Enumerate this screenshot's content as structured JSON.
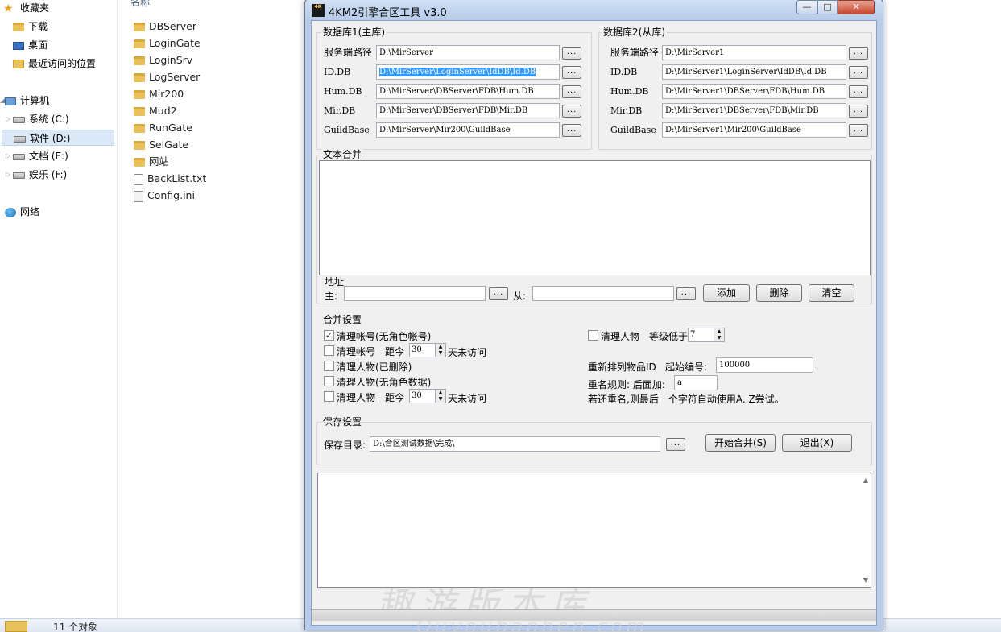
{
  "explorer": {
    "column_header": "名称",
    "nav": [
      {
        "label": "收藏夹",
        "icon": "star-icon"
      },
      {
        "label": "下载",
        "icon": "download-folder-icon"
      },
      {
        "label": "桌面",
        "icon": "desktop-icon"
      },
      {
        "label": "最近访问的位置",
        "icon": "recent-places-icon"
      },
      {
        "label": "计算机",
        "icon": "computer-icon"
      },
      {
        "label": "系统 (C:)",
        "icon": "drive-icon"
      },
      {
        "label": "软件 (D:)",
        "icon": "drive-icon"
      },
      {
        "label": "文档 (E:)",
        "icon": "drive-icon"
      },
      {
        "label": "娱乐 (F:)",
        "icon": "drive-icon"
      },
      {
        "label": "网络",
        "icon": "network-icon"
      }
    ],
    "files": [
      {
        "name": "DBServer",
        "icon": "folder-icon"
      },
      {
        "name": "LoginGate",
        "icon": "folder-icon"
      },
      {
        "name": "LoginSrv",
        "icon": "folder-icon"
      },
      {
        "name": "LogServer",
        "icon": "folder-icon"
      },
      {
        "name": "Mir200",
        "icon": "folder-icon"
      },
      {
        "name": "Mud2",
        "icon": "folder-icon"
      },
      {
        "name": "RunGate",
        "icon": "folder-icon"
      },
      {
        "name": "SelGate",
        "icon": "folder-icon"
      },
      {
        "name": "网站",
        "icon": "folder-icon"
      },
      {
        "name": "BackList.txt",
        "icon": "text-file-icon"
      },
      {
        "name": "Config.ini",
        "icon": "ini-file-icon"
      }
    ],
    "status": "11 个对象"
  },
  "window": {
    "title": "4KM2引擎合区工具 v3.0",
    "app_icon_text": "4K",
    "min_glyph": "—",
    "max_glyph": "□",
    "close_glyph": "✕"
  },
  "db1": {
    "title": "数据库1(主库)",
    "server_path_label": "服务端路径",
    "server_path": "D:\\MirServer",
    "id_label": "ID.DB",
    "id_path": "D:\\MirServer\\LoginServer\\IdDB\\Id.DB",
    "hum_label": "Hum.DB",
    "hum_path": "D:\\MirServer\\DBServer\\FDB\\Hum.DB",
    "mir_label": "Mir.DB",
    "mir_path": "D:\\MirServer\\DBServer\\FDB\\Mir.DB",
    "guild_label": "GuildBase",
    "guild_path": "D:\\MirServer\\Mir200\\GuildBase"
  },
  "db2": {
    "title": "数据库2(从库)",
    "server_path_label": "服务端路径",
    "server_path": "D:\\MirServer1",
    "id_label": "ID.DB",
    "id_path": "D:\\MirServer1\\LoginServer\\IdDB\\Id.DB",
    "hum_label": "Hum.DB",
    "hum_path": "D:\\MirServer1\\DBServer\\FDB\\Hum.DB",
    "mir_label": "Mir.DB",
    "mir_path": "D:\\MirServer1\\DBServer\\FDB\\Mir.DB",
    "guild_label": "GuildBase",
    "guild_path": "D:\\MirServer1\\Mir200\\GuildBase"
  },
  "browse_label": "...",
  "text_merge": {
    "title": "文本合并",
    "address_label": "地址",
    "main_label": "主:",
    "main_value": "",
    "from_label": "从:",
    "from_value": "",
    "add_label": "添加",
    "delete_label": "删除",
    "clear_label": "清空"
  },
  "merge_settings": {
    "title": "合并设置",
    "clear_accounts_no_char": {
      "label": "清理帐号(无角色帐号)",
      "checked": true
    },
    "clear_accounts_days": {
      "label": "清理帐号",
      "checked": false,
      "distance_label": "距今",
      "days": "30",
      "suffix": "天未访问"
    },
    "clear_chars_deleted": {
      "label": "清理人物(已删除)",
      "checked": false
    },
    "clear_chars_no_data": {
      "label": "清理人物(无角色数据)",
      "checked": false
    },
    "clear_chars_days": {
      "label": "清理人物",
      "checked": false,
      "distance_label": "距今",
      "days": "30",
      "suffix": "天未访问"
    },
    "clear_chars_level": {
      "label": "清理人物",
      "checked": false,
      "level_label": "等级低于",
      "level": "7"
    },
    "reorder_items_label": "重新排列物品ID",
    "start_number_label": "起始编号:",
    "start_number": "100000",
    "rename_rule_label": "重名规则: 后面加:",
    "rename_suffix": "a",
    "rename_note": "若还重名,则最后一个字符自动使用A..Z尝试。"
  },
  "save_settings": {
    "title": "保存设置",
    "dir_label": "保存目录:",
    "dir_value": "D:\\合区测试数据\\完成\\",
    "start_label": "开始合并(S)",
    "exit_label": "退出(X)"
  },
  "log": {
    "watermark": "趣游版本库",
    "watermark_sub": "Quyoubanben.com"
  }
}
